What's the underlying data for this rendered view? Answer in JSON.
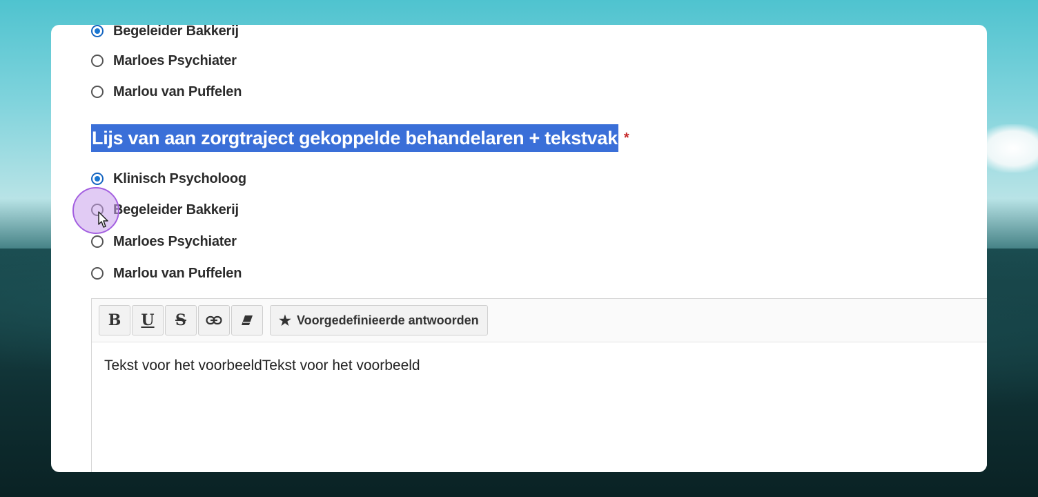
{
  "group1": {
    "options": [
      {
        "label": "Begeleider Bakkerij",
        "checked": true
      },
      {
        "label": "Marloes Psychiater",
        "checked": false
      },
      {
        "label": "Marlou van Puffelen",
        "checked": false
      }
    ]
  },
  "group2": {
    "title": "Lijs van aan zorgtraject gekoppelde behandelaren + tekstvak",
    "required_mark": "*",
    "options": [
      {
        "label": "Klinisch Psycholoog",
        "checked": true
      },
      {
        "label": "Begeleider Bakkerij",
        "checked": false
      },
      {
        "label": "Marloes Psychiater",
        "checked": false
      },
      {
        "label": "Marlou van Puffelen",
        "checked": false
      }
    ]
  },
  "editor": {
    "toolbar": {
      "bold": "B",
      "underline": "U",
      "strike": "S",
      "predefined_label": "Voorgedefinieerde antwoorden"
    },
    "content": "Tekst voor het voorbeeldTekst voor het voorbeeld"
  },
  "colors": {
    "accent": "#1976d2",
    "highlight": "#3a6fd8",
    "required": "#c62828"
  }
}
